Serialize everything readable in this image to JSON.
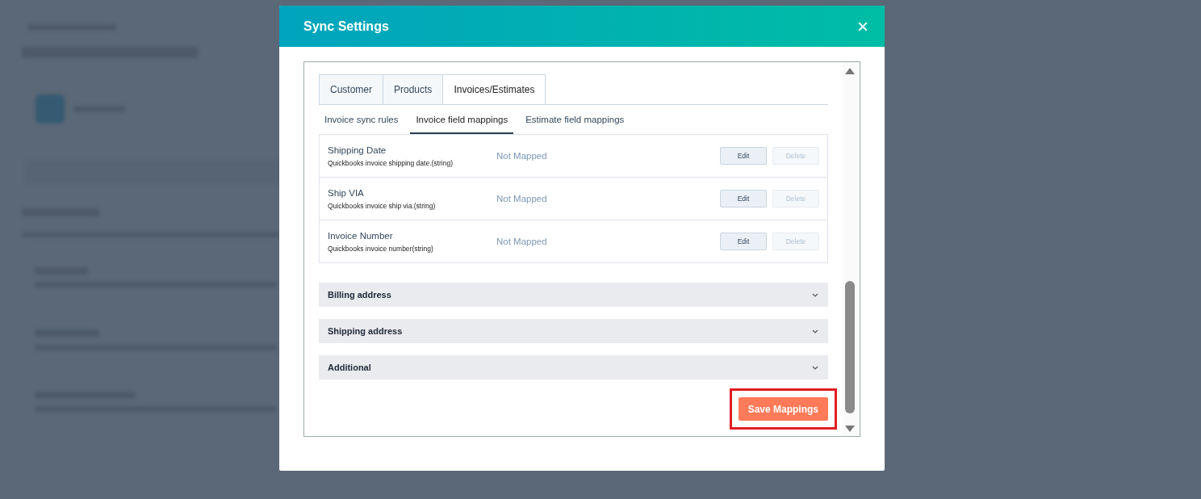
{
  "window": {
    "title": "Sync Settings",
    "close": "×"
  },
  "tabs": [
    {
      "label": "Customer",
      "selected": false
    },
    {
      "label": "Products",
      "selected": false
    },
    {
      "label": "Invoices/Estimates",
      "selected": true
    }
  ],
  "subtabs": [
    {
      "label": "Invoice sync rules",
      "selected": false
    },
    {
      "label": "Invoice field mappings",
      "selected": true
    },
    {
      "label": "Estimate field mappings",
      "selected": false
    }
  ],
  "mappings": [
    {
      "name": "Shipping Date",
      "description": "Quickbooks invoice shipping date.(string)",
      "status": "Not Mapped",
      "actions": [
        {
          "label": "Edit",
          "disabled": false
        },
        {
          "label": "Delete",
          "disabled": true
        }
      ]
    },
    {
      "name": "Ship VIA",
      "description": "Quickbooks invoice ship via.(string)",
      "status": "Not Mapped",
      "actions": [
        {
          "label": "Edit",
          "disabled": false
        },
        {
          "label": "Delete",
          "disabled": true
        }
      ]
    },
    {
      "name": "Invoice Number",
      "description": "Quickbooks invoice number(string)",
      "status": "Not Mapped",
      "actions": [
        {
          "label": "Edit",
          "disabled": false
        },
        {
          "label": "Delete",
          "disabled": true
        }
      ]
    }
  ],
  "sections": [
    {
      "title": "Billing address",
      "expanded": false
    },
    {
      "title": "Shipping address",
      "expanded": false
    },
    {
      "title": "Additional",
      "expanded": false
    }
  ],
  "save_button": {
    "label": "Save Mappings",
    "highlighted": true
  }
}
